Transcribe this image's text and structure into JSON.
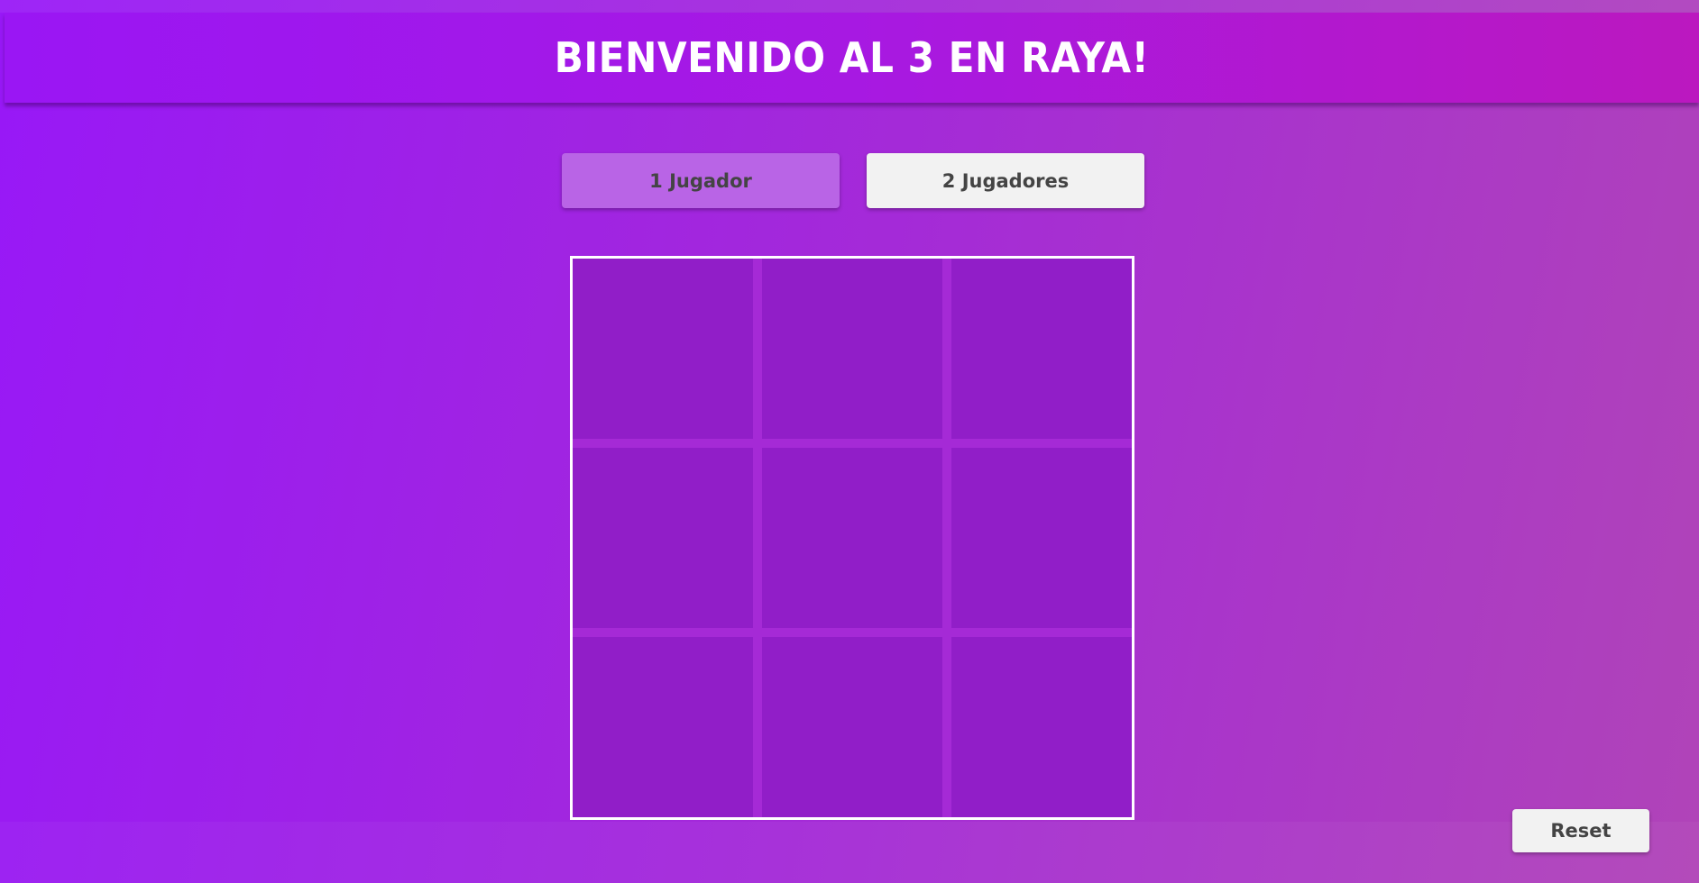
{
  "header": {
    "title": "BIENVENIDO AL 3 EN RAYA!"
  },
  "modes": {
    "one_player_label": "1 Jugador",
    "two_players_label": "2 Jugadores",
    "selected": "1 Jugador"
  },
  "board": {
    "rows": 3,
    "cols": 3,
    "cells": [
      "",
      "",
      "",
      "",
      "",
      "",
      "",
      "",
      ""
    ]
  },
  "controls": {
    "reset_label": "Reset"
  },
  "colors": {
    "background_start": "#9818f7",
    "background_end": "#b044b8",
    "header_start": "#9a16f4",
    "header_end": "#bb18bf",
    "selected_mode": "#b964e6",
    "button": "#f2f2f2",
    "button_text": "#444444",
    "board_border": "#ffffff"
  }
}
